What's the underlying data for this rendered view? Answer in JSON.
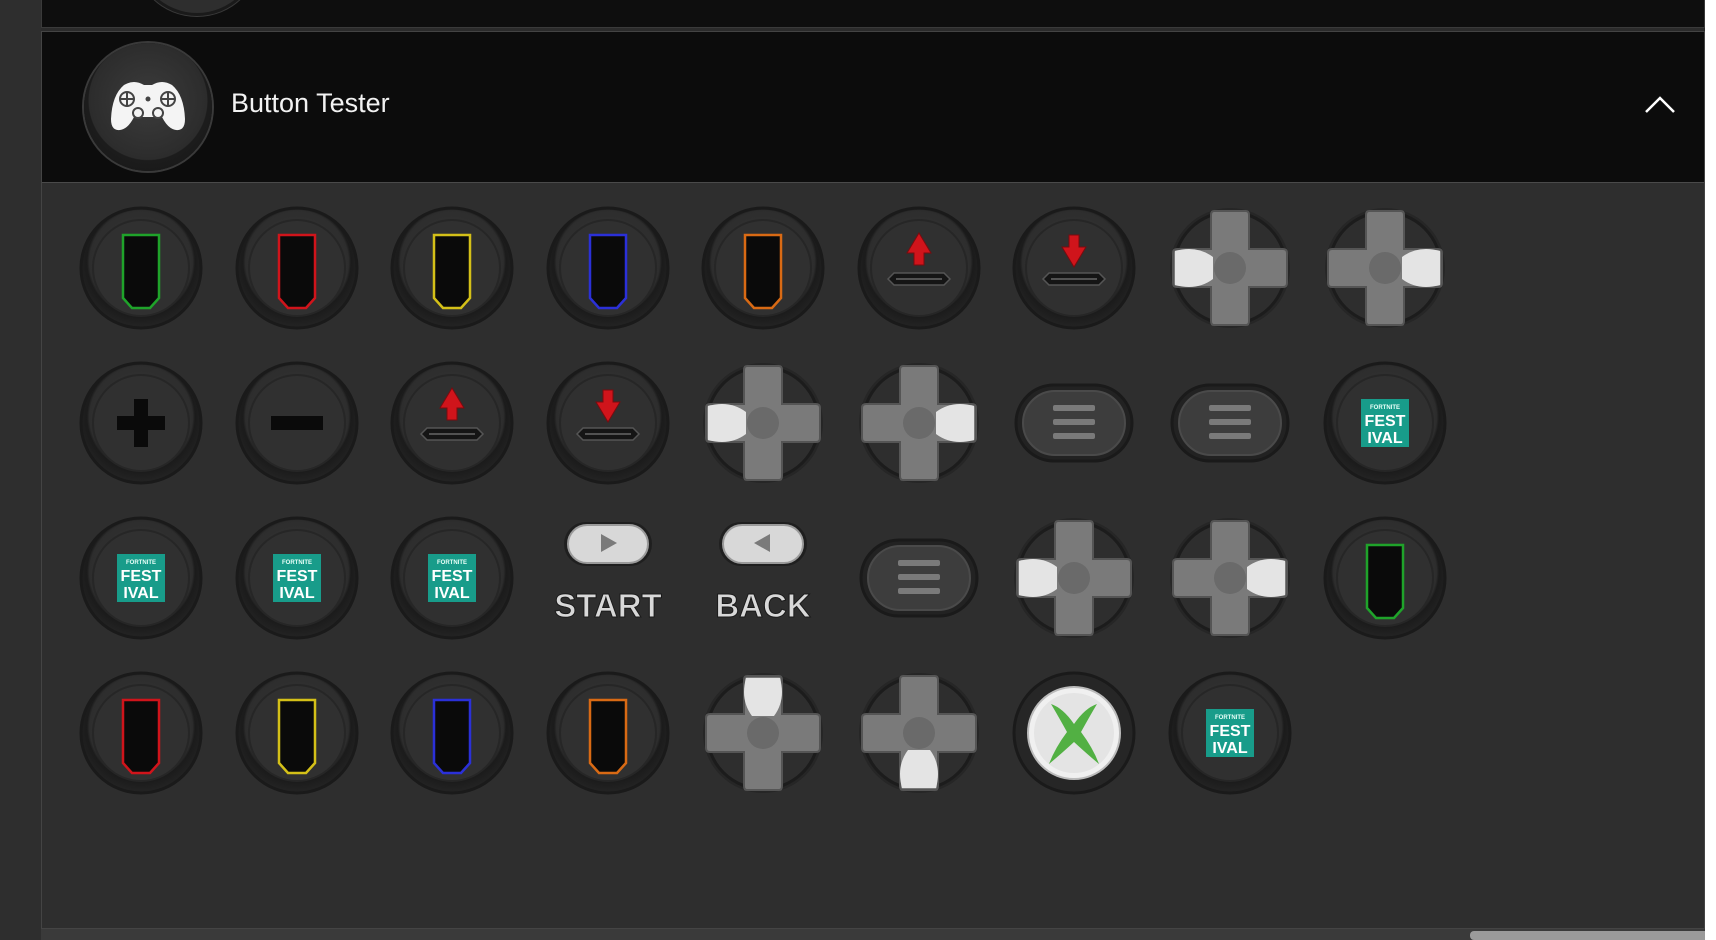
{
  "panel": {
    "title": "Button Tester",
    "header_icon": "gamepad-icon",
    "collapse_icon": "chevron-up-icon"
  },
  "colors": {
    "green": "#1fa32a",
    "red": "#d0141b",
    "yellow": "#d4c018",
    "blue": "#2b30d8",
    "orange": "#d96a14",
    "teal": "#189c8a",
    "xbox_green": "#52b043"
  },
  "labels": {
    "start": "START",
    "back": "BACK",
    "festival_top": "FORTNITE",
    "festival_fest": "FEST",
    "festival_ival": "IVAL"
  },
  "buttons": [
    {
      "name": "green-fret-button",
      "icon": "shield-icon",
      "color": "green"
    },
    {
      "name": "red-fret-button",
      "icon": "shield-icon",
      "color": "red"
    },
    {
      "name": "yellow-fret-button",
      "icon": "shield-icon",
      "color": "yellow"
    },
    {
      "name": "blue-fret-button",
      "icon": "shield-icon",
      "color": "blue"
    },
    {
      "name": "orange-fret-button",
      "icon": "shield-icon",
      "color": "orange"
    },
    {
      "name": "strum-up-button",
      "icon": "arrow-up-icon"
    },
    {
      "name": "strum-down-button",
      "icon": "arrow-down-icon"
    },
    {
      "name": "dpad-left-button",
      "icon": "dpad-left-icon"
    },
    {
      "name": "dpad-right-button",
      "icon": "dpad-right-icon"
    },
    {
      "name": "plus-button",
      "icon": "plus-icon"
    },
    {
      "name": "minus-button",
      "icon": "minus-icon"
    },
    {
      "name": "strum-up-button-2",
      "icon": "arrow-up-icon"
    },
    {
      "name": "strum-down-button-2",
      "icon": "arrow-down-icon"
    },
    {
      "name": "dpad-left-button-2",
      "icon": "dpad-left-icon"
    },
    {
      "name": "dpad-right-button-2",
      "icon": "dpad-right-icon"
    },
    {
      "name": "menu-button",
      "icon": "menu-icon"
    },
    {
      "name": "menu-button-2",
      "icon": "menu-icon"
    },
    {
      "name": "festival-button",
      "icon": "fortnite-festival-icon"
    },
    {
      "name": "festival-button-2",
      "icon": "fortnite-festival-icon"
    },
    {
      "name": "festival-button-3",
      "icon": "fortnite-festival-icon"
    },
    {
      "name": "festival-button-4",
      "icon": "fortnite-festival-icon"
    },
    {
      "name": "start-button",
      "icon": "play-icon",
      "label": "START"
    },
    {
      "name": "back-button",
      "icon": "back-icon",
      "label": "BACK"
    },
    {
      "name": "menu-button-3",
      "icon": "menu-icon"
    },
    {
      "name": "dpad-left-button-3",
      "icon": "dpad-left-icon"
    },
    {
      "name": "dpad-right-button-3",
      "icon": "dpad-right-icon"
    },
    {
      "name": "green-fret-button-2",
      "icon": "shield-icon",
      "color": "green"
    },
    {
      "name": "red-fret-button-2",
      "icon": "shield-icon",
      "color": "red"
    },
    {
      "name": "yellow-fret-button-2",
      "icon": "shield-icon",
      "color": "yellow"
    },
    {
      "name": "blue-fret-button-2",
      "icon": "shield-icon",
      "color": "blue"
    },
    {
      "name": "orange-fret-button-2",
      "icon": "shield-icon",
      "color": "orange"
    },
    {
      "name": "dpad-up-button",
      "icon": "dpad-up-icon"
    },
    {
      "name": "dpad-down-button",
      "icon": "dpad-down-icon"
    },
    {
      "name": "xbox-guide-button",
      "icon": "xbox-logo-icon"
    },
    {
      "name": "festival-button-5",
      "icon": "fortnite-festival-icon"
    }
  ]
}
